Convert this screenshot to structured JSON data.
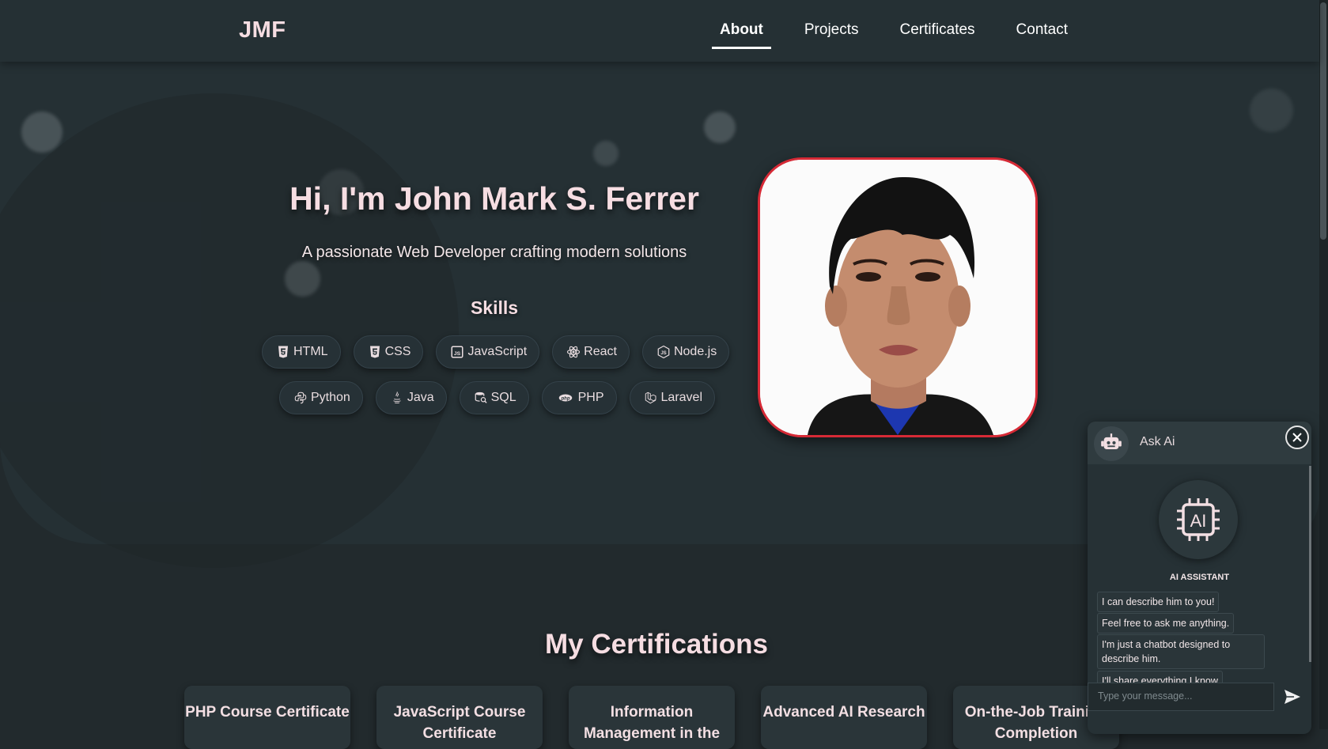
{
  "nav": {
    "logo": "JMF",
    "links": [
      "About",
      "Projects",
      "Certificates",
      "Contact"
    ],
    "active": "About"
  },
  "hero": {
    "title": "Hi, I'm John Mark S. Ferrer",
    "subtitle": "A passionate Web Developer crafting modern solutions",
    "skills_title": "Skills",
    "skills_row1": [
      {
        "label": "HTML",
        "icon": "html5-icon"
      },
      {
        "label": "CSS",
        "icon": "css3-icon"
      },
      {
        "label": "JavaScript",
        "icon": "javascript-icon"
      },
      {
        "label": "React",
        "icon": "react-icon"
      },
      {
        "label": "Node.js",
        "icon": "nodejs-icon"
      }
    ],
    "skills_row2": [
      {
        "label": "Python",
        "icon": "python-icon"
      },
      {
        "label": "Java",
        "icon": "java-icon"
      },
      {
        "label": "SQL",
        "icon": "database-icon"
      },
      {
        "label": "PHP",
        "icon": "php-icon"
      },
      {
        "label": "Laravel",
        "icon": "laravel-icon"
      }
    ],
    "photo": "profile-photo"
  },
  "certifications": {
    "title": "My Certifications",
    "cards": [
      "PHP Course Certificate",
      "JavaScript Course Certificate",
      "Information Management in the",
      "Advanced AI Research",
      "On-the-Job Training Completion"
    ]
  },
  "chat": {
    "title": "Ask Ai",
    "emblem_text": "AI",
    "assistant_label": "AI ASSISTANT",
    "messages": [
      "I can describe him to you!",
      "Feel free to ask me anything.",
      "I'm just a chatbot designed to describe him.",
      "I'll share everything I know"
    ],
    "input_placeholder": "Type your message..."
  },
  "colors": {
    "background": "#222a2d",
    "surface": "#253034",
    "accent_text": "#f6dde2",
    "photo_border": "#d62a36"
  }
}
